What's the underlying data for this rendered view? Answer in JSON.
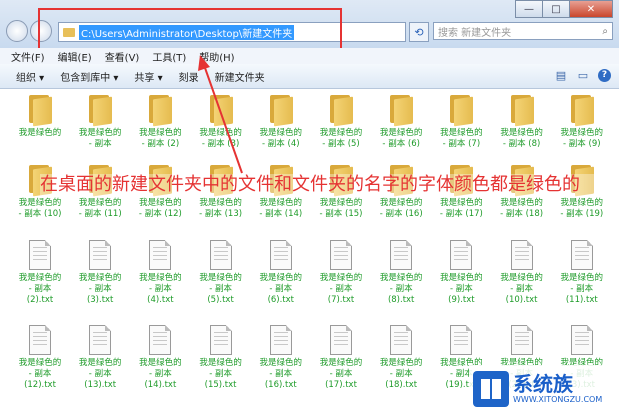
{
  "window": {
    "address_path": "C:\\Users\\Administrator\\Desktop\\新建文件夹",
    "search_placeholder": "搜索 新建文件夹",
    "controls": [
      "—",
      "□",
      "✕"
    ]
  },
  "menu": [
    "文件(F)",
    "编辑(E)",
    "查看(V)",
    "工具(T)",
    "帮助(H)"
  ],
  "toolbar": [
    "组织 ▾",
    "包含到库中 ▾",
    "共享 ▾",
    "刻录",
    "新建文件夹"
  ],
  "files": [
    {
      "type": "folder",
      "lines": [
        "我是绿色的",
        ""
      ]
    },
    {
      "type": "folder",
      "lines": [
        "我是绿色的",
        "- 副本"
      ]
    },
    {
      "type": "folder",
      "lines": [
        "我是绿色的",
        "- 副本 (2)"
      ]
    },
    {
      "type": "folder",
      "lines": [
        "我是绿色的",
        "- 副本 (3)"
      ]
    },
    {
      "type": "folder",
      "lines": [
        "我是绿色的",
        "- 副本 (4)"
      ]
    },
    {
      "type": "folder",
      "lines": [
        "我是绿色的",
        "- 副本 (5)"
      ]
    },
    {
      "type": "folder",
      "lines": [
        "我是绿色的",
        "- 副本 (6)"
      ]
    },
    {
      "type": "folder",
      "lines": [
        "我是绿色的",
        "- 副本 (7)"
      ]
    },
    {
      "type": "folder",
      "lines": [
        "我是绿色的",
        "- 副本 (8)"
      ]
    },
    {
      "type": "folder",
      "lines": [
        "我是绿色的",
        "- 副本 (9)"
      ]
    },
    {
      "type": "folder",
      "lines": [
        "我是绿色的",
        "- 副本 (10)"
      ]
    },
    {
      "type": "folder",
      "lines": [
        "我是绿色的",
        "- 副本 (11)"
      ]
    },
    {
      "type": "folder",
      "lines": [
        "我是绿色的",
        "- 副本 (12)"
      ]
    },
    {
      "type": "folder",
      "lines": [
        "我是绿色的",
        "- 副本 (13)"
      ]
    },
    {
      "type": "folder",
      "lines": [
        "我是绿色的",
        "- 副本 (14)"
      ]
    },
    {
      "type": "folder",
      "lines": [
        "我是绿色的",
        "- 副本 (15)"
      ]
    },
    {
      "type": "folder",
      "lines": [
        "我是绿色的",
        "- 副本 (16)"
      ]
    },
    {
      "type": "folder",
      "lines": [
        "我是绿色的",
        "- 副本 (17)"
      ]
    },
    {
      "type": "folder",
      "lines": [
        "我是绿色的",
        "- 副本 (18)"
      ]
    },
    {
      "type": "folder",
      "lines": [
        "我是绿色的",
        "- 副本 (19)"
      ]
    },
    {
      "type": "txt",
      "lines": [
        "我是绿色的",
        "- 副本",
        "(2).txt"
      ]
    },
    {
      "type": "txt",
      "lines": [
        "我是绿色的",
        "- 副本",
        "(3).txt"
      ]
    },
    {
      "type": "txt",
      "lines": [
        "我是绿色的",
        "- 副本",
        "(4).txt"
      ]
    },
    {
      "type": "txt",
      "lines": [
        "我是绿色的",
        "- 副本",
        "(5).txt"
      ]
    },
    {
      "type": "txt",
      "lines": [
        "我是绿色的",
        "- 副本",
        "(6).txt"
      ]
    },
    {
      "type": "txt",
      "lines": [
        "我是绿色的",
        "- 副本",
        "(7).txt"
      ]
    },
    {
      "type": "txt",
      "lines": [
        "我是绿色的",
        "- 副本",
        "(8).txt"
      ]
    },
    {
      "type": "txt",
      "lines": [
        "我是绿色的",
        "- 副本",
        "(9).txt"
      ]
    },
    {
      "type": "txt",
      "lines": [
        "我是绿色的",
        "- 副本",
        "(10).txt"
      ]
    },
    {
      "type": "txt",
      "lines": [
        "我是绿色的",
        "- 副本",
        "(11).txt"
      ]
    },
    {
      "type": "txt",
      "lines": [
        "我是绿色的",
        "- 副本",
        "(12).txt"
      ]
    },
    {
      "type": "txt",
      "lines": [
        "我是绿色的",
        "- 副本",
        "(13).txt"
      ]
    },
    {
      "type": "txt",
      "lines": [
        "我是绿色的",
        "- 副本",
        "(14).txt"
      ]
    },
    {
      "type": "txt",
      "lines": [
        "我是绿色的",
        "- 副本",
        "(15).txt"
      ]
    },
    {
      "type": "txt",
      "lines": [
        "我是绿色的",
        "- 副本",
        "(16).txt"
      ]
    },
    {
      "type": "txt",
      "lines": [
        "我是绿色的",
        "- 副本",
        "(17).txt"
      ]
    },
    {
      "type": "txt",
      "lines": [
        "我是绿色的",
        "- 副本",
        "(18).txt"
      ]
    },
    {
      "type": "txt",
      "lines": [
        "我是绿色的",
        "- 副本",
        "(19).txt"
      ]
    },
    {
      "type": "txt",
      "lines": [
        "我是绿色的",
        "- 副本",
        "(2).txt"
      ]
    },
    {
      "type": "txt",
      "lines": [
        "我是绿色的",
        "- 副本",
        "(3).txt"
      ]
    }
  ],
  "annotation": "在桌面的新建文件夹中的文件和文件夹的名字的字体颜色都是绿色的",
  "watermark": {
    "title": "系统族",
    "url": "WWW.XITONGZU.COM"
  },
  "colors": {
    "label_green": "#1e9b29",
    "annotation_red": "#e53333",
    "selection_blue": "#3399ff"
  }
}
